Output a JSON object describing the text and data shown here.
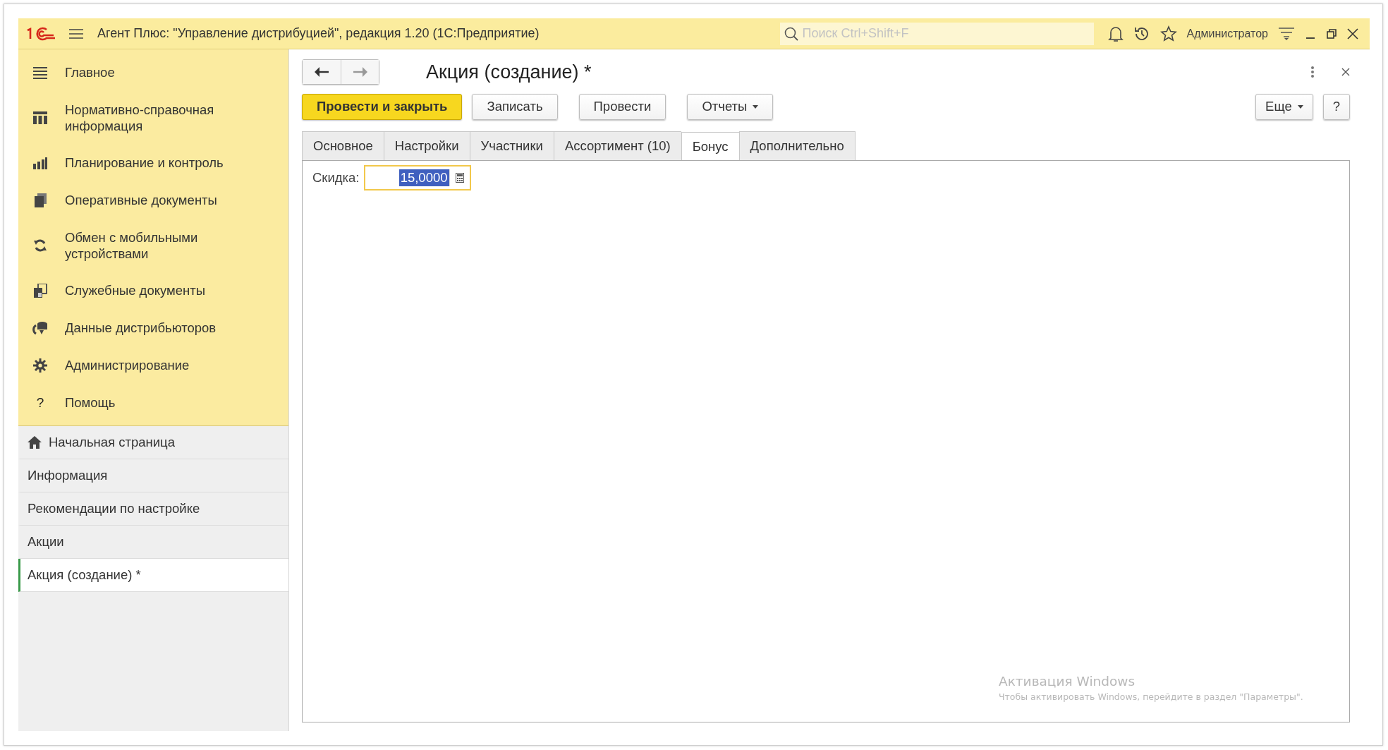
{
  "window": {
    "title": "Агент Плюс: \"Управление дистрибуцией\", редакция 1.20  (1С:Предприятие)",
    "search": {
      "placeholder": "Поиск Ctrl+Shift+F"
    },
    "user": "Администратор"
  },
  "sections": [
    {
      "label": "Главное",
      "kind": "menu"
    },
    {
      "label": "Нормативно-справочная информация",
      "kind": "catalog"
    },
    {
      "label": "Планирование и контроль",
      "kind": "chart"
    },
    {
      "label": "Оперативные документы",
      "kind": "documents"
    },
    {
      "label": "Обмен с мобильными устройствами",
      "kind": "sync"
    },
    {
      "label": "Служебные документы",
      "kind": "service"
    },
    {
      "label": "Данные дистрибьюторов",
      "kind": "distributors"
    },
    {
      "label": "Администрирование",
      "kind": "gear"
    },
    {
      "label": "Помощь",
      "kind": "help",
      "glyph": "?"
    }
  ],
  "open_windows": [
    {
      "label": "Начальная страница",
      "kind": "home",
      "selected": false
    },
    {
      "label": "Информация",
      "kind": "plain",
      "selected": false
    },
    {
      "label": "Рекомендации по настройке",
      "kind": "plain",
      "selected": false
    },
    {
      "label": "Акции",
      "kind": "plain",
      "selected": false
    },
    {
      "label": "Акция (создание) *",
      "kind": "plain",
      "selected": true
    }
  ],
  "form": {
    "title": "Акция (создание) *",
    "buttons": [
      {
        "label": "Провести и закрыть",
        "kind": "primary"
      },
      {
        "label": "Записать",
        "kind": "plain"
      },
      {
        "label": "Провести",
        "kind": "plain"
      },
      {
        "label": "Отчеты",
        "kind": "dropdown"
      }
    ],
    "right_buttons": [
      {
        "label": "Еще",
        "kind": "dropdown"
      },
      {
        "label": "?",
        "kind": "plain"
      }
    ],
    "tabs": [
      {
        "label": "Основное",
        "selected": false
      },
      {
        "label": "Настройки",
        "selected": false
      },
      {
        "label": "Участники",
        "selected": false
      },
      {
        "label": "Ассортимент (10)",
        "selected": false
      },
      {
        "label": "Бонус",
        "selected": true
      },
      {
        "label": "Дополнительно",
        "selected": false
      }
    ],
    "fields": [
      {
        "label": "Скидка:",
        "value": "15,0000",
        "selected": true
      }
    ]
  },
  "activation_notice": {
    "title": "Активация Windows",
    "text": "Чтобы активировать Windows, перейдите в раздел \"Параметры\"."
  }
}
